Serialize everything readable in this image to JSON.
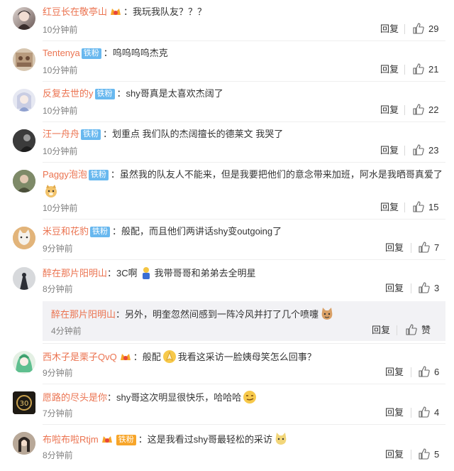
{
  "comments": [
    {
      "user": "红豆长在敬亭山",
      "badge": null,
      "colon": "：",
      "text": "我玩我队友？？？",
      "time": "10分钟前",
      "reply": "回复",
      "likes": "29"
    },
    {
      "user": "Tentenya",
      "badge": "铁粉",
      "colon": "：",
      "text": "呜呜呜呜杰克",
      "time": "10分钟前",
      "reply": "回复",
      "likes": "21"
    },
    {
      "user": "反复去世的y",
      "badge": "铁粉",
      "colon": "：",
      "text": "shy哥真是太喜欢杰阔了",
      "time": "10分钟前",
      "reply": "回复",
      "likes": "22"
    },
    {
      "user": "汪一舟舟",
      "badge": "铁粉",
      "colon": "：",
      "text": "划重点 我们队的杰阔擅长的德莱文 我哭了",
      "time": "10分钟前",
      "reply": "回复",
      "likes": "23"
    },
    {
      "user": "Paggy泡泡",
      "badge": "铁粉",
      "colon": "：",
      "text": "虽然我的队友人不能来，但是我要把他们的意念带来加班，阿水是我晒哥真爱了",
      "time": "10分钟前",
      "reply": "回复",
      "likes": "15"
    },
    {
      "user": "米豆和花豹",
      "badge": "铁粉",
      "colon": "：",
      "text": "般配，而且他们两讲话shy变outgoing了",
      "time": "9分钟前",
      "reply": "回复",
      "likes": "7"
    },
    {
      "user": "醉在那片阳明山",
      "badge": null,
      "colon": "：",
      "text_a": "3C啊",
      "text_b": "我带哥哥和弟弟去全明星",
      "time": "8分钟前",
      "reply": "回复",
      "likes": "3"
    },
    {
      "user": "西木子是栗子QvQ",
      "badge": null,
      "colon": "：",
      "text_a": "般配",
      "text_b": "我看这采访一脸姨母笑怎么回事？",
      "time": "9分钟前",
      "reply": "回复",
      "likes": "6"
    },
    {
      "user": "愿路的尽头是你",
      "badge": null,
      "colon": "：",
      "text": "shy哥这次明显很快乐，哈哈哈",
      "time": "7分钟前",
      "reply": "回复",
      "likes": "4"
    },
    {
      "user": "布啦布啦Rtjm",
      "badge": "铁粉",
      "colon": "：",
      "text": "这是我看过shy哥最轻松的采访",
      "time": "8分钟前",
      "reply": "回复",
      "likes": "5"
    }
  ],
  "subreply": {
    "user": "醉在那片阳明山",
    "colon": "：",
    "text": "另外，明奎忽然间感到一阵冷风并打了几个喷嚏",
    "time": "4分钟前",
    "reply": "回复",
    "likes": "赞"
  },
  "colors": {
    "username": "#eb7350",
    "badge": "#68b8ef",
    "time": "#808080",
    "quote_bg": "#f2f2f5"
  }
}
